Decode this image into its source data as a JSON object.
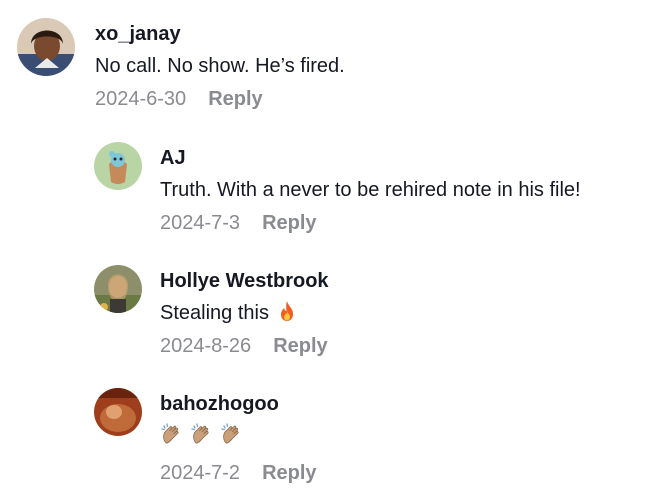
{
  "comments": [
    {
      "username": "xo_janay",
      "text": "No call. No show. He’s fired.",
      "date": "2024-6-30",
      "reply_label": "Reply",
      "avatar_icon": "user-avatar-photo"
    },
    {
      "username": "AJ",
      "text": "Truth. With a never to be rehired note in his file!",
      "date": "2024-7-3",
      "reply_label": "Reply",
      "avatar_icon": "cartoon-avatar"
    },
    {
      "username": "Hollye Westbrook",
      "text": "Stealing this",
      "emoji": "fire-emoji",
      "date": "2024-8-26",
      "reply_label": "Reply",
      "avatar_icon": "user-avatar-photo"
    },
    {
      "username": "bahozhogoo",
      "emoji": "clapping-hands-emoji x3",
      "date": "2024-7-2",
      "reply_label": "Reply",
      "avatar_icon": "user-avatar-photo"
    }
  ],
  "colors": {
    "text": "#161823",
    "muted": "#8a8b91",
    "background": "#ffffff"
  }
}
